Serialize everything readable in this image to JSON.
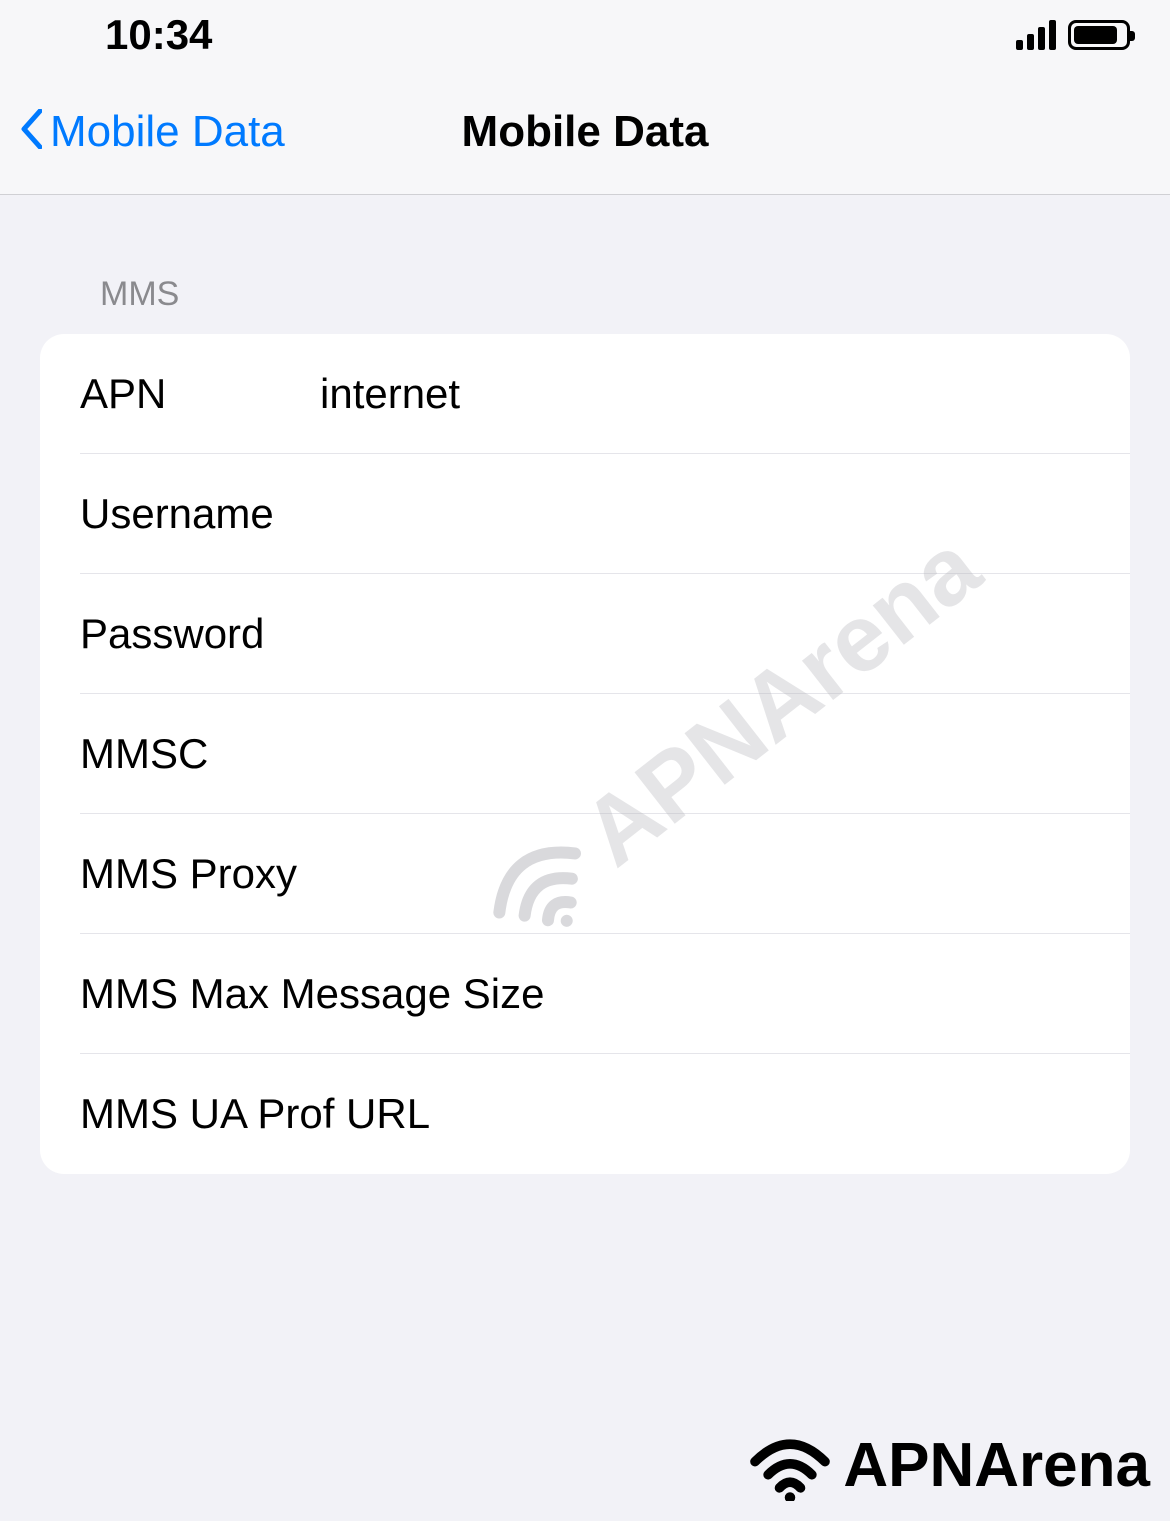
{
  "status": {
    "time": "10:34"
  },
  "nav": {
    "back_label": "Mobile Data",
    "title": "Mobile Data"
  },
  "section": {
    "header": "MMS"
  },
  "fields": {
    "apn": {
      "label": "APN",
      "value": "internet"
    },
    "username": {
      "label": "Username",
      "value": ""
    },
    "password": {
      "label": "Password",
      "value": ""
    },
    "mmsc": {
      "label": "MMSC",
      "value": ""
    },
    "mms_proxy": {
      "label": "MMS Proxy",
      "value": ""
    },
    "mms_max": {
      "label": "MMS Max Message Size",
      "value": ""
    },
    "mms_ua": {
      "label": "MMS UA Prof URL",
      "value": ""
    }
  },
  "watermark": {
    "center": "APNArena",
    "footer": "APNArena"
  }
}
